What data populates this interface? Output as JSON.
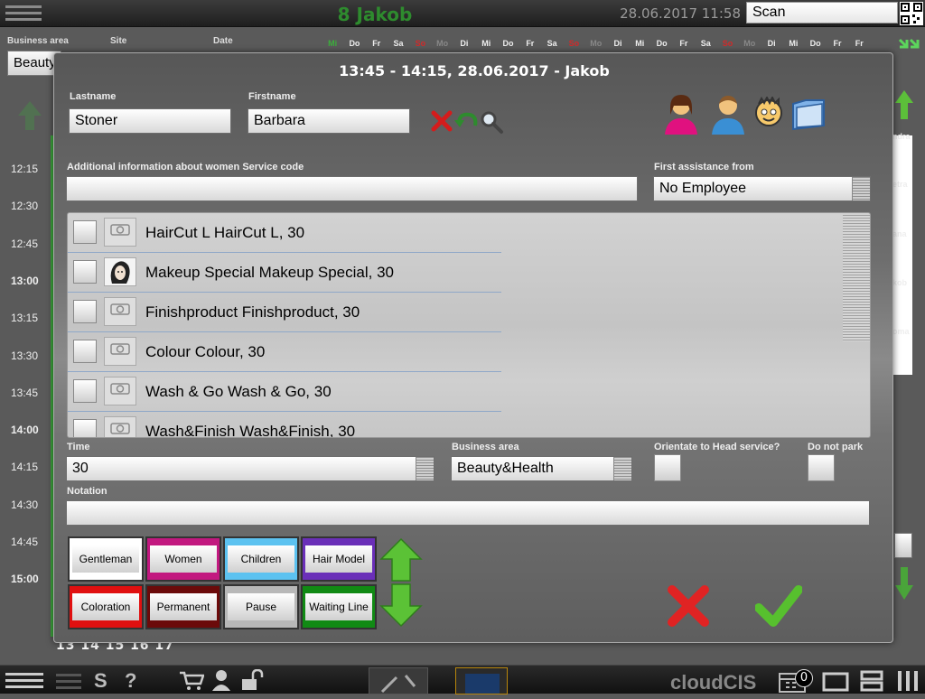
{
  "top_bar": {
    "employee_title": "8 Jakob",
    "datetime": "28.06.2017 11:58",
    "scan_value": "Scan"
  },
  "filters": {
    "business_area_label": "Business area",
    "business_area_value": "Beauty",
    "site_label": "Site",
    "date_label": "Date"
  },
  "weekdays": [
    {
      "label": "Mi",
      "color": "#3cae3c"
    },
    {
      "label": "Do",
      "color": "#eeeeee"
    },
    {
      "label": "Fr",
      "color": "#eeeeee"
    },
    {
      "label": "Sa",
      "color": "#eeeeee"
    },
    {
      "label": "So",
      "color": "#d22a2a"
    },
    {
      "label": "Mo",
      "color": "#888888"
    },
    {
      "label": "Di",
      "color": "#eeeeee"
    },
    {
      "label": "Mi",
      "color": "#eeeeee"
    },
    {
      "label": "Do",
      "color": "#eeeeee"
    },
    {
      "label": "Fr",
      "color": "#eeeeee"
    },
    {
      "label": "Sa",
      "color": "#eeeeee"
    },
    {
      "label": "So",
      "color": "#d22a2a"
    },
    {
      "label": "Mo",
      "color": "#888888"
    },
    {
      "label": "Di",
      "color": "#eeeeee"
    },
    {
      "label": "Mi",
      "color": "#eeeeee"
    },
    {
      "label": "Do",
      "color": "#eeeeee"
    },
    {
      "label": "Fr",
      "color": "#eeeeee"
    },
    {
      "label": "Sa",
      "color": "#eeeeee"
    },
    {
      "label": "So",
      "color": "#d22a2a"
    },
    {
      "label": "Mo",
      "color": "#888888"
    },
    {
      "label": "Di",
      "color": "#eeeeee"
    },
    {
      "label": "Mi",
      "color": "#eeeeee"
    },
    {
      "label": "Do",
      "color": "#eeeeee"
    },
    {
      "label": "Fr",
      "color": "#eeeeee"
    },
    {
      "label": "Fr",
      "color": "#eeeeee"
    }
  ],
  "time_slots": [
    "12:15",
    "12:30",
    "12:45",
    "13:00",
    "13:15",
    "13:30",
    "13:45",
    "14:00",
    "14:15",
    "14:30",
    "14:45",
    "15:00"
  ],
  "bold_time_slots": [
    "13:00",
    "14:00",
    "15:00"
  ],
  "day_numbers": "13 14 15 16 17",
  "right_names": [
    "ndra",
    "etra",
    "ana",
    "kob",
    "oma"
  ],
  "bottom_bar": {
    "s_label": "S",
    "help_label": "?",
    "brand": "cloudCIS",
    "badge_count": "0"
  },
  "dialog": {
    "title": "13:45 - 14:15, 28.06.2017 - Jakob",
    "lastname_label": "Lastname",
    "lastname_value": "Stoner",
    "firstname_label": "Firstname",
    "firstname_value": "Barbara",
    "additional_info_label": "Additional information about women Service code",
    "additional_info_value": "",
    "first_assistance_label": "First assistance from",
    "first_assistance_value": "No Employee",
    "services": [
      {
        "name": "HairCut L HairCut L, 30",
        "has_photo": false
      },
      {
        "name": "Makeup Special Makeup Special, 30",
        "has_photo": true
      },
      {
        "name": "Finishproduct Finishproduct, 30",
        "has_photo": false
      },
      {
        "name": "Colour Colour, 30",
        "has_photo": false
      },
      {
        "name": "Wash & Go Wash & Go, 30",
        "has_photo": false
      },
      {
        "name": "Wash&Finish Wash&Finish, 30",
        "has_photo": false
      }
    ],
    "time_label": "Time",
    "time_value": "30",
    "business_area_label": "Business area",
    "business_area_value": "Beauty&Health",
    "orientate_label": "Orientate to Head service?",
    "do_not_park_label": "Do not park",
    "notation_label": "Notation",
    "notation_value": "",
    "categories": [
      {
        "label": "Gentleman",
        "color": "#ffffff"
      },
      {
        "label": "Women",
        "color": "#c2187f"
      },
      {
        "label": "Children",
        "color": "#5cc2f0"
      },
      {
        "label": "Hair Model",
        "color": "#6a2fb8"
      },
      {
        "label": "Coloration",
        "color": "#e01010"
      },
      {
        "label": "Permanent",
        "color": "#6b0a0a"
      },
      {
        "label": "Pause",
        "color": "#b8b8b8"
      },
      {
        "label": "Waiting Line",
        "color": "#118a14"
      }
    ]
  }
}
